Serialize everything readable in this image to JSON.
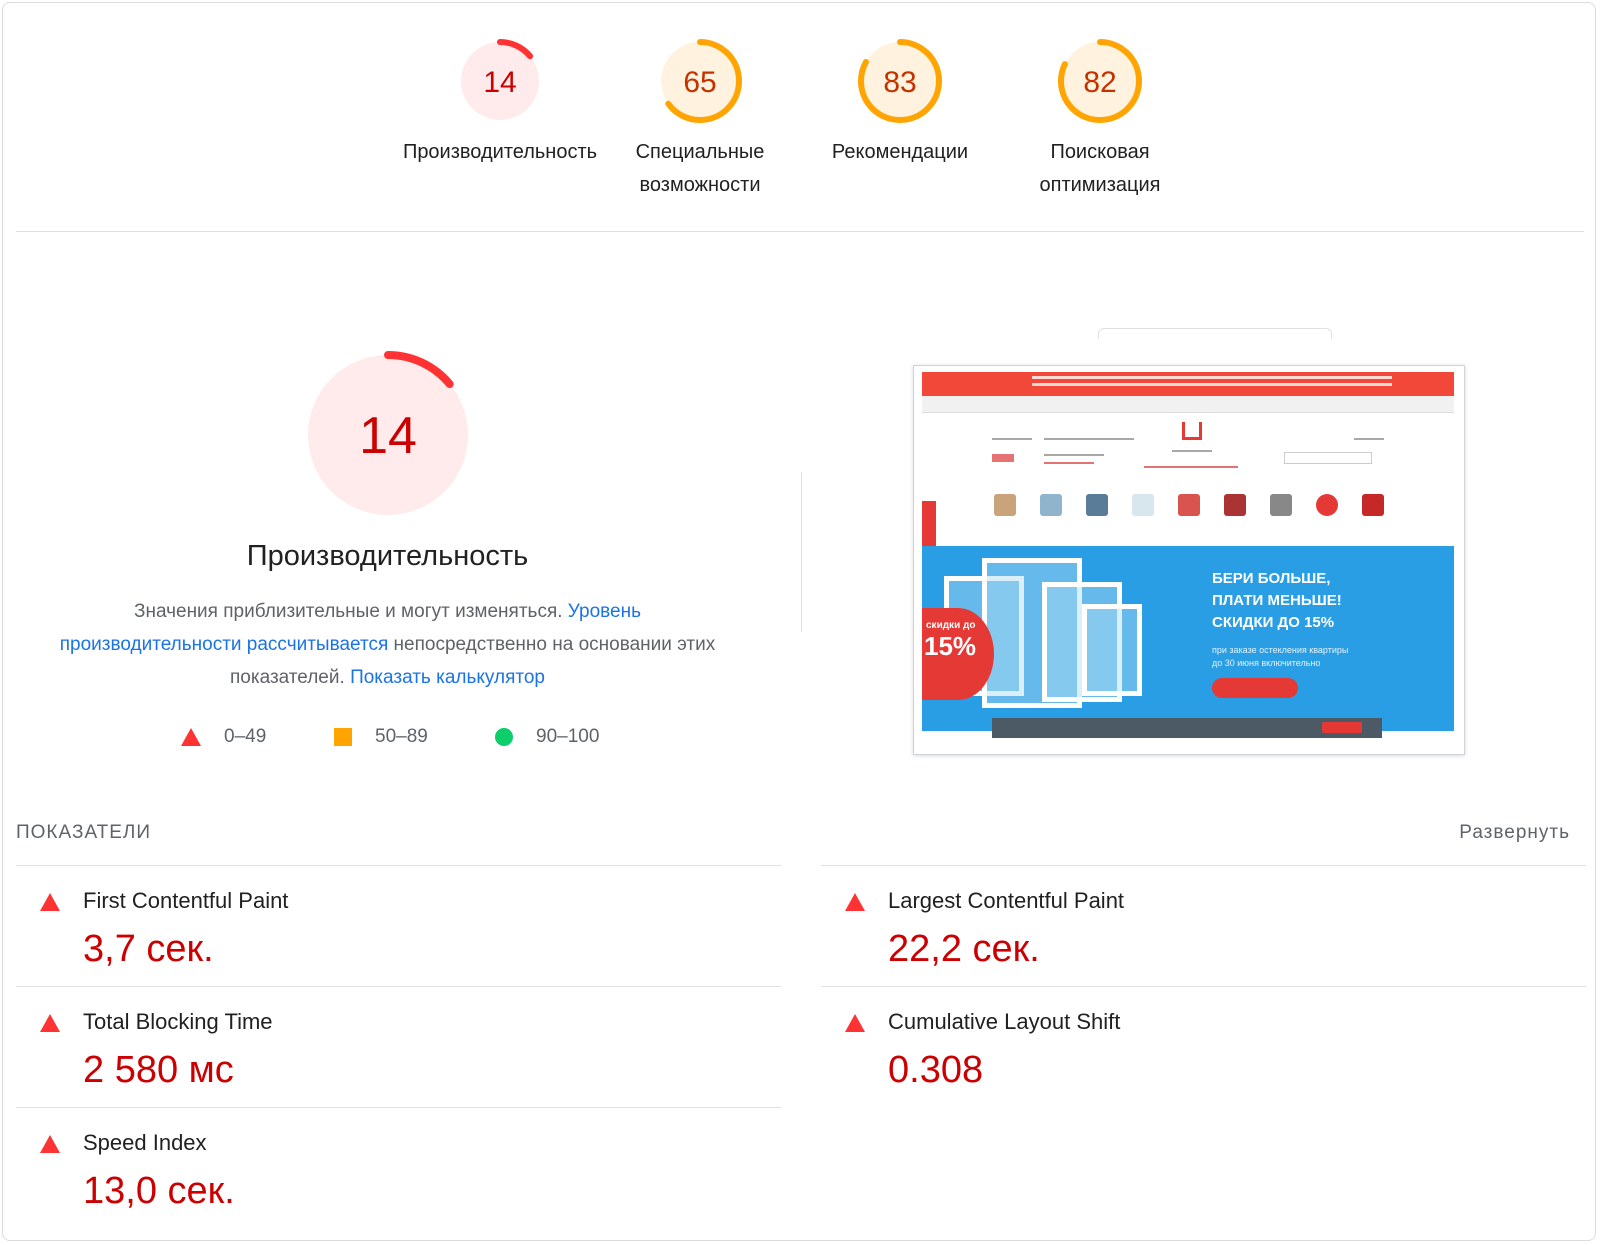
{
  "categories": [
    {
      "score": "14",
      "fraction": 0.14,
      "label": "Производительность",
      "color": "#ff3333",
      "bg": "#ffebeb",
      "text": "#c00"
    },
    {
      "score": "65",
      "fraction": 0.65,
      "label": "Специальные возможности",
      "color": "#ffa400",
      "bg": "#fff3e0",
      "text": "#c33300"
    },
    {
      "score": "83",
      "fraction": 0.83,
      "label": "Рекомендации",
      "color": "#ffa400",
      "bg": "#fff3e0",
      "text": "#c33300"
    },
    {
      "score": "82",
      "fraction": 0.82,
      "label": "Поисковая оптимизация",
      "color": "#ffa400",
      "bg": "#fff3e0",
      "text": "#c33300"
    }
  ],
  "performance": {
    "score": "14",
    "fraction": 0.14,
    "title": "Производительность",
    "desc_text1": "Значения приблизительные и могут изменяться. ",
    "desc_link1": "Уровень производительности рассчитывается",
    "desc_text2": " непосредственно на основании этих показателей. ",
    "desc_link2": "Показать калькулятор"
  },
  "legend": [
    {
      "range": "0–49",
      "shape": "triangle",
      "color": "#ff3333"
    },
    {
      "range": "50–89",
      "shape": "square",
      "color": "#ffa400"
    },
    {
      "range": "90–100",
      "shape": "circle",
      "color": "#0cce6b"
    }
  ],
  "screenshot": {
    "promo_heading": [
      "БЕРИ БОЛЬШЕ,",
      "ПЛАТИ МЕНЬШЕ!",
      "СКИДКИ ДО 15%"
    ],
    "promo_sub": [
      "при заказе остекления квартиры",
      "до 30 июня включительно"
    ],
    "badge_label": "скидки до",
    "badge_value": "15%"
  },
  "metrics_section": {
    "heading": "ПОКАЗАТЕЛИ",
    "expand_label": "Развернуть"
  },
  "metrics": [
    {
      "name": "First Contentful Paint",
      "value": "3,7 сек."
    },
    {
      "name": "Largest Contentful Paint",
      "value": "22,2 сек."
    },
    {
      "name": "Total Blocking Time",
      "value": "2 580 мс"
    },
    {
      "name": "Cumulative Layout Shift",
      "value": "0.308"
    },
    {
      "name": "Speed Index",
      "value": "13,0 сек."
    }
  ],
  "status_color": "#ff3333"
}
